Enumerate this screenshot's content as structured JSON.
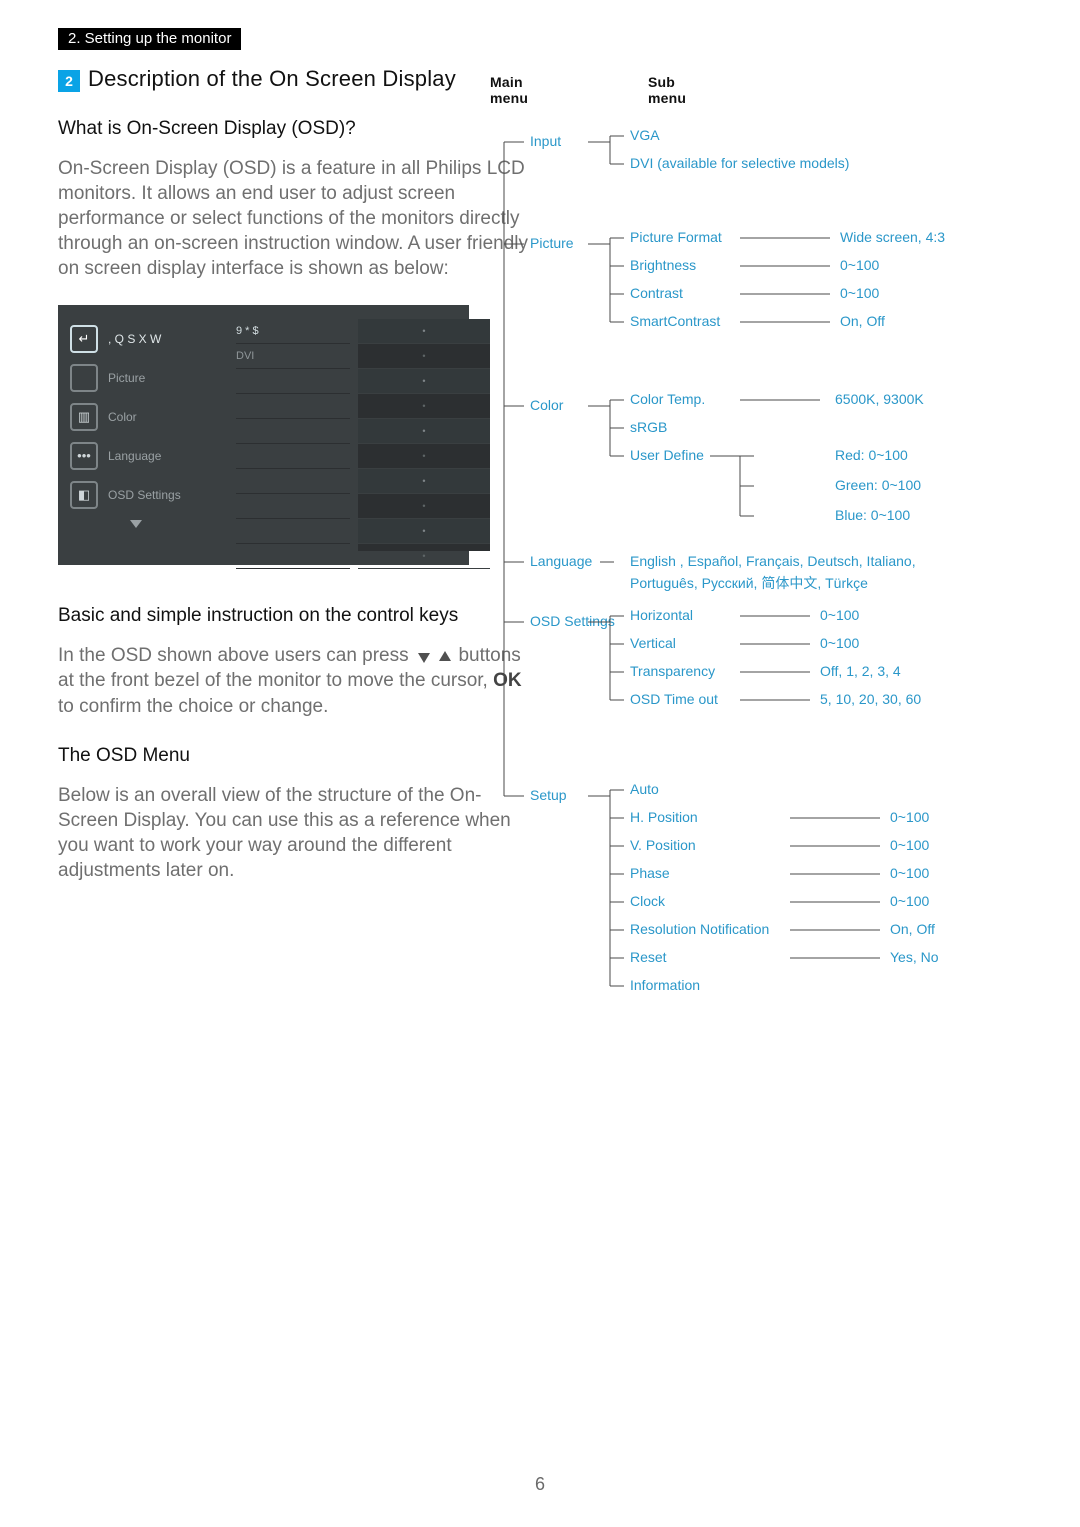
{
  "chapter_bar": "2. Setting up the monitor",
  "section": {
    "num": "2",
    "title": "Description of the On Screen Display"
  },
  "q_what_heading": "What is On-Screen Display (OSD)?",
  "q_what_body": "On-Screen Display (OSD) is a feature in all Philips LCD monitors. It allows an end user to adjust screen performance or select functions of the monitors directly through an on-screen instruction window. A user friendly on screen display interface is shown as below:",
  "osd_shot": {
    "side": [
      {
        "label": ", Q S X W",
        "sel": true,
        "icon": "↵"
      },
      {
        "label": "Picture",
        "icon": " "
      },
      {
        "label": "Color",
        "icon": "▥"
      },
      {
        "label": "Language",
        "icon": "•••"
      },
      {
        "label": "OSD Settings",
        "icon": "◧"
      }
    ],
    "mid": [
      {
        "label": "9 * $",
        "sel": true
      },
      {
        "label": "DVI"
      }
    ]
  },
  "h_basic": "Basic and simple instruction on the control keys",
  "body_basic_pre": "In the OSD shown above users can press ",
  "body_basic_post": " buttons at the front bezel of the monitor to move the cursor, ",
  "ok_label": "OK",
  "body_basic_tail": " to confirm the choice or change.",
  "h_menu": "The OSD Menu",
  "body_menu": "Below is an overall view of the structure of the On-Screen Display. You can use this as a reference when you want to work your way around the different adjustments later on.",
  "tree_headers": {
    "main": "Main menu",
    "sub": "Sub menu"
  },
  "tree": {
    "input": {
      "label": "Input",
      "items": [
        {
          "label": "VGA"
        },
        {
          "label": "DVI (available for selective models)"
        }
      ]
    },
    "picture": {
      "label": "Picture",
      "items": [
        {
          "label": "Picture Format",
          "val": "Wide screen, 4:3"
        },
        {
          "label": "Brightness",
          "val": "0~100"
        },
        {
          "label": "Contrast",
          "val": "0~100"
        },
        {
          "label": "SmartContrast",
          "val": "On, Off"
        }
      ]
    },
    "color": {
      "label": "Color",
      "items": [
        {
          "label": "Color Temp.",
          "val": "6500K, 9300K"
        },
        {
          "label": "sRGB"
        },
        {
          "label": "User Define",
          "children": [
            {
              "label": "Red: 0~100"
            },
            {
              "label": "Green: 0~100"
            },
            {
              "label": "Blue: 0~100"
            }
          ]
        }
      ]
    },
    "language": {
      "label": "Language",
      "val": "English , Español, Français, Deutsch, Italiano, Português, Русский, 简体中文, Türkçe"
    },
    "osd": {
      "label": "OSD Settings",
      "items": [
        {
          "label": "Horizontal",
          "val": "0~100"
        },
        {
          "label": "Vertical",
          "val": "0~100"
        },
        {
          "label": "Transparency",
          "val": "Off, 1, 2, 3, 4"
        },
        {
          "label": "OSD Time out",
          "val": "5, 10, 20, 30, 60"
        }
      ]
    },
    "setup": {
      "label": "Setup",
      "items": [
        {
          "label": "Auto"
        },
        {
          "label": "H. Position",
          "val": "0~100"
        },
        {
          "label": "V. Position",
          "val": "0~100"
        },
        {
          "label": "Phase",
          "val": "0~100"
        },
        {
          "label": "Clock",
          "val": "0~100"
        },
        {
          "label": "Resolution Notification",
          "val": "On, Off"
        },
        {
          "label": "Reset",
          "val": "Yes, No"
        },
        {
          "label": "Information"
        }
      ]
    }
  },
  "page_number": "6"
}
